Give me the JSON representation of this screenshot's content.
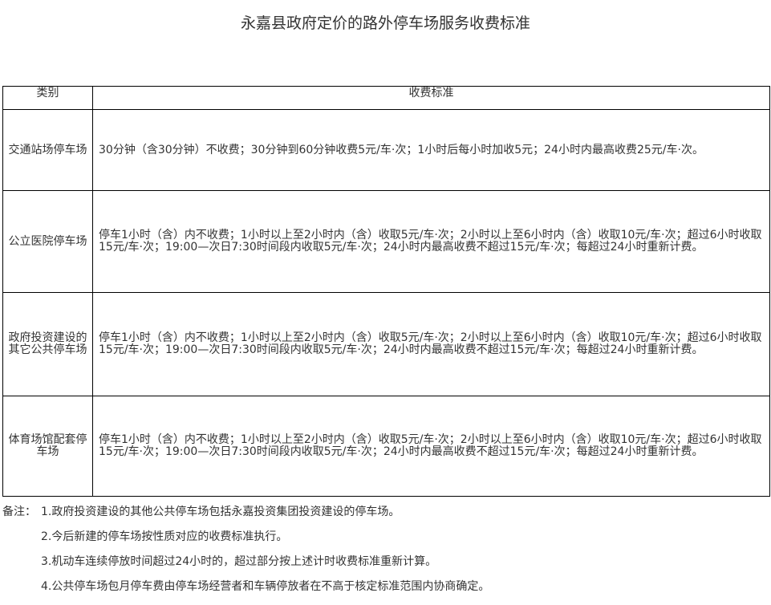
{
  "title": "永嘉县政府定价的路外停车场服务收费标准",
  "table": {
    "headers": [
      "类别",
      "收费标准"
    ],
    "rows": [
      {
        "category": "交通站场停车场",
        "standard": "30分钟（含30分钟）不收费；30分钟到60分钟收费5元/车·次；1小时后每小时加收5元；24小时内最高收费25元/车·次。"
      },
      {
        "category": "公立医院停车场",
        "standard": "停车1小时（含）内不收费；1小时以上至2小时内（含）收取5元/车·次；2小时以上至6小时内（含）收取10元/车·次；超过6小时收取15元/车·次；19:00—次日7:30时间段内收取5元/车·次；24小时内最高收费不超过15元/车·次；每超过24小时重新计费。"
      },
      {
        "category": "政府投资建设的其它公共停车场",
        "standard": "停车1小时（含）内不收费；1小时以上至2小时内（含）收取5元/车·次；2小时以上至6小时内（含）收取10元/车·次；超过6小时收取15元/车·次；19:00—次日7:30时间段内收取5元/车·次；24小时内最高收费不超过15元/车·次；每超过24小时重新计费。"
      },
      {
        "category": "体育场馆配套停车场",
        "standard": "停车1小时（含）内不收费；1小时以上至2小时内（含）收取5元/车·次；2小时以上至6小时内（含）收取10元/车·次；超过6小时收取15元/车·次；19:00—次日7:30时间段内收取5元/车·次；24小时内最高收费不超过15元/车·次；每超过24小时重新计费。"
      }
    ]
  },
  "notes": {
    "prefix": "备注：",
    "items": [
      "1.政府投资建设的其他公共停车场包括永嘉投资集团投资建设的停车场。",
      "2.今后新建的停车场按性质对应的收费标准执行。",
      "3.机动车连续停放时间超过24小时的，超过部分按上述计时收费标准重新计算。",
      "4.公共停车场包月停车费由停车场经营者和车辆停放者在不高于核定标准范围内协商确定。"
    ]
  }
}
